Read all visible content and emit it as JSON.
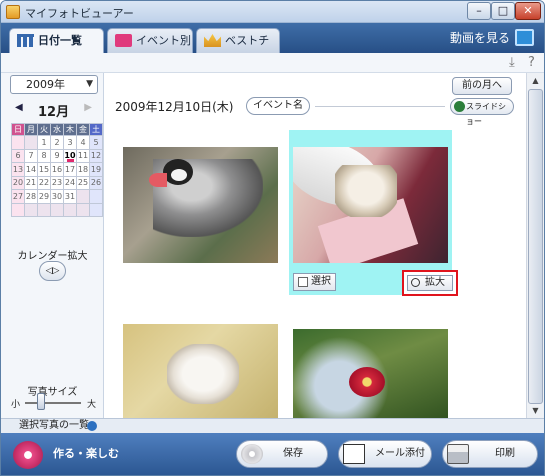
{
  "window": {
    "title": "マイフォトビューアー"
  },
  "tabs": [
    {
      "label": "日付一覧",
      "icon": "calendar-grid-icon"
    },
    {
      "label": "イベント別",
      "icon": "music-icon"
    },
    {
      "label": "ベストチョイス",
      "icon": "crown-icon"
    }
  ],
  "slideshow_top": {
    "label": "動画を見る",
    "icon": "slideshow-icon"
  },
  "sidebar": {
    "year": "2009年",
    "month": "12月",
    "prev_arrow": "◀",
    "next_arrow": "▶",
    "weekday_headers": [
      "日",
      "月",
      "火",
      "水",
      "木",
      "金",
      "土"
    ],
    "weeks": [
      [
        "",
        "",
        "1",
        "2",
        "3",
        "4",
        "5"
      ],
      [
        "6",
        "7",
        "8",
        "9",
        "10",
        "11",
        "12"
      ],
      [
        "13",
        "14",
        "15",
        "16",
        "17",
        "18",
        "19"
      ],
      [
        "20",
        "21",
        "22",
        "23",
        "24",
        "25",
        "26"
      ],
      [
        "27",
        "28",
        "29",
        "30",
        "31",
        "",
        ""
      ],
      [
        "",
        "",
        "",
        "",
        "",
        "",
        ""
      ]
    ],
    "highlighted_day": "10",
    "calendar_zoom_label": "カレンダー拡大",
    "photo_size_label": "写真サイズ",
    "size_small": "小",
    "size_large": "大",
    "photo_size_level": 0.25
  },
  "main": {
    "prev_month_button": "前の月へ",
    "date_heading": "2009年12月10日(木)",
    "event_name_button": "イベント名",
    "slideshow_button": "スライドショー",
    "select_checkbox_label": "選択",
    "zoom_button_label": "拡大"
  },
  "bottom": {
    "selected_list_label": "選択写真の一覧",
    "create_label": "作る・楽しむ",
    "save_button": "保存",
    "mail_button": "メール添付",
    "print_button": "印刷"
  }
}
